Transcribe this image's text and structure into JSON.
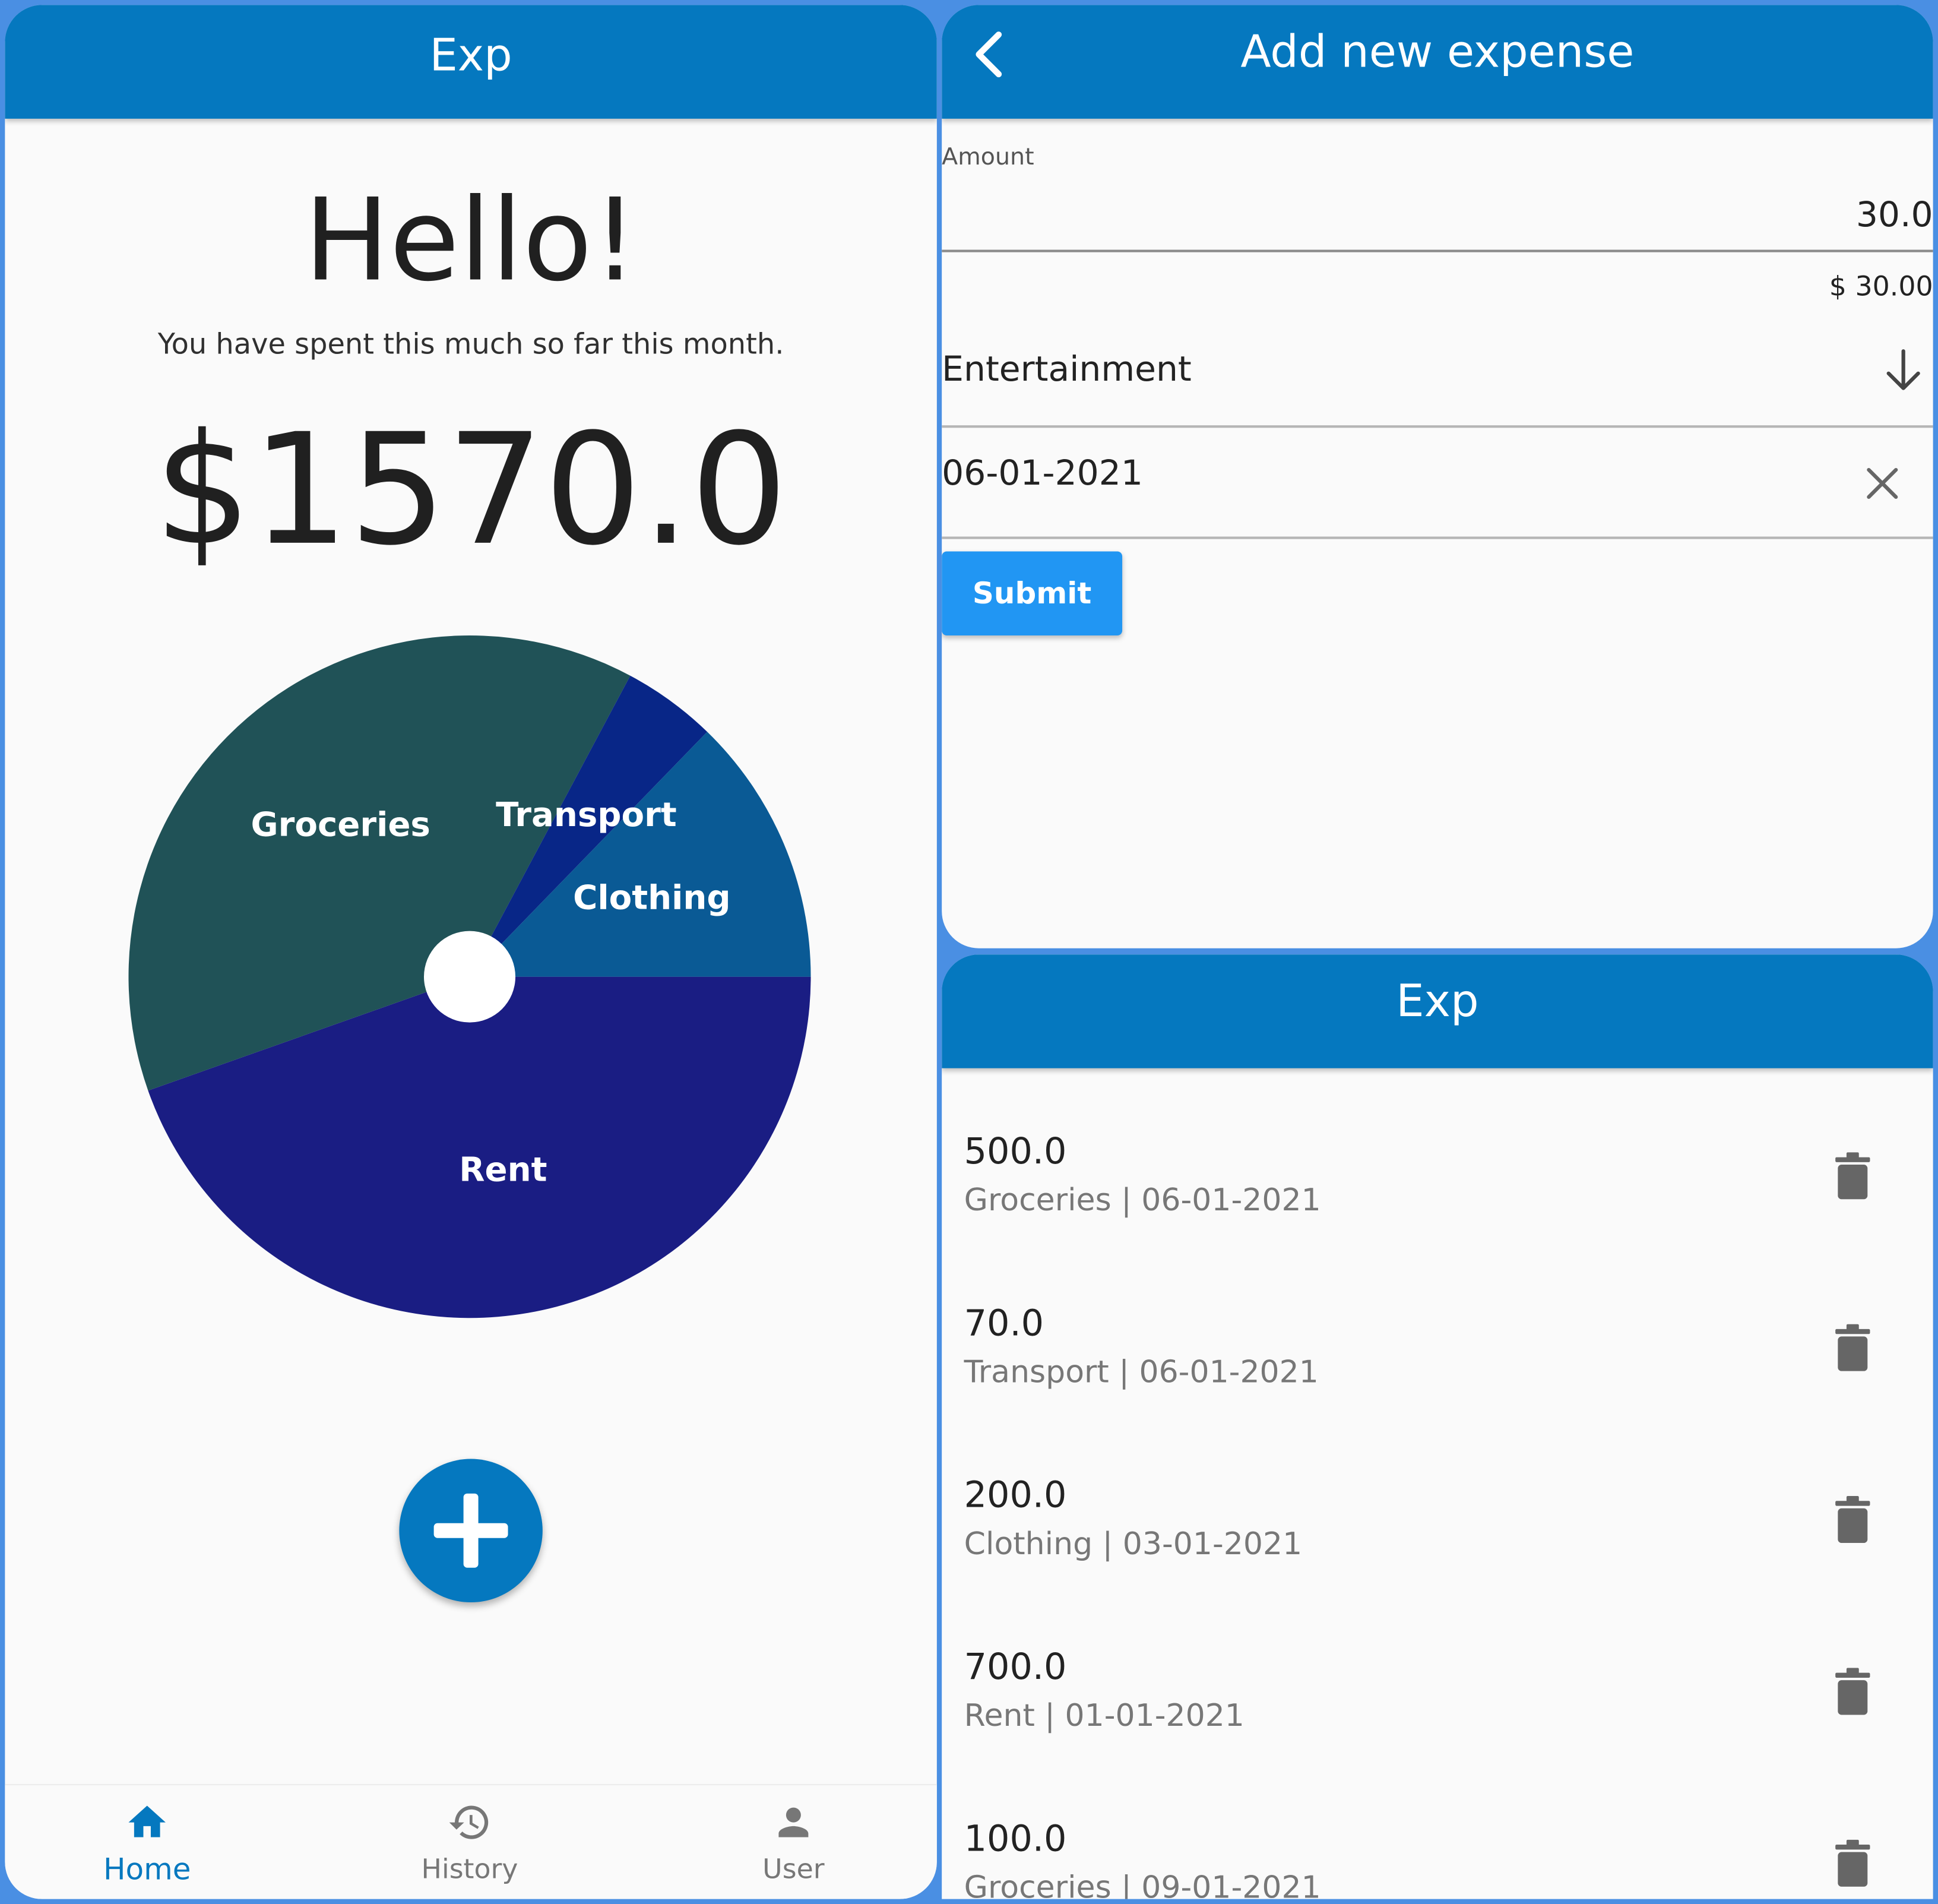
{
  "colors": {
    "background": "#4a8fe3",
    "appbar": "#0578bf",
    "primary_button": "#2196f3",
    "panel": "#fafafa"
  },
  "home": {
    "appbar_title": "Exp",
    "greeting": "Hello!",
    "subtitle": "You have spent this much so far this month.",
    "total": "$1570.0",
    "fab_icon": "plus-icon",
    "nav": [
      {
        "label": "Home",
        "icon": "home-icon",
        "active": true
      },
      {
        "label": "History",
        "icon": "history-icon",
        "active": false
      },
      {
        "label": "User",
        "icon": "user-icon",
        "active": false
      }
    ]
  },
  "chart_data": {
    "type": "pie",
    "hole": true,
    "categories": [
      "Rent",
      "Groceries",
      "Transport",
      "Clothing"
    ],
    "values": [
      700,
      600,
      70,
      200
    ],
    "colors": [
      "#1a1d83",
      "#205257",
      "#082687",
      "#0a5a95"
    ]
  },
  "add_expense": {
    "title": "Add new expense",
    "back_icon": "chevron-left-icon",
    "amount_label": "Amount",
    "amount_value": "30.0",
    "amount_formatted": "$ 30.00",
    "category_value": "Entertainment",
    "category_icon": "arrow-down-icon",
    "date_value": "06-01-2021",
    "clear_icon": "close-icon",
    "submit_label": "Submit"
  },
  "history": {
    "appbar_title": "Exp",
    "delete_icon": "trash-icon",
    "rows": [
      {
        "amount": "500.0",
        "sub": "Groceries | 06-01-2021"
      },
      {
        "amount": "70.0",
        "sub": "Transport | 06-01-2021"
      },
      {
        "amount": "200.0",
        "sub": "Clothing | 03-01-2021"
      },
      {
        "amount": "700.0",
        "sub": "Rent | 01-01-2021"
      },
      {
        "amount": "100.0",
        "sub": "Groceries | 09-01-2021"
      }
    ]
  }
}
